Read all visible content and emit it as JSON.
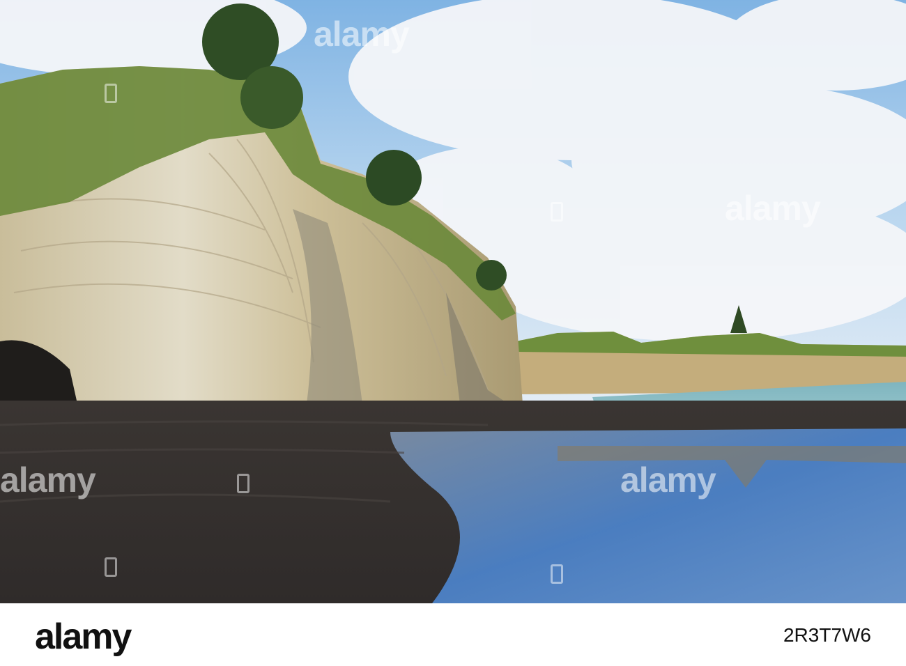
{
  "photo": {
    "description_colors": {
      "sky": "#9fc6e8",
      "cloud": "#f3f5f8",
      "cliff": "#d8cdb0",
      "cliff_shadow": "#8d8a7c",
      "vegetation": "#6e8c3a",
      "sand": "#3f3a38",
      "sea": "#8fc3c9",
      "reflection": "#5f8fc9"
    }
  },
  "watermarks": {
    "text": "alamy"
  },
  "footer": {
    "brand": "alamy",
    "image_code": "2R3T7W6"
  }
}
